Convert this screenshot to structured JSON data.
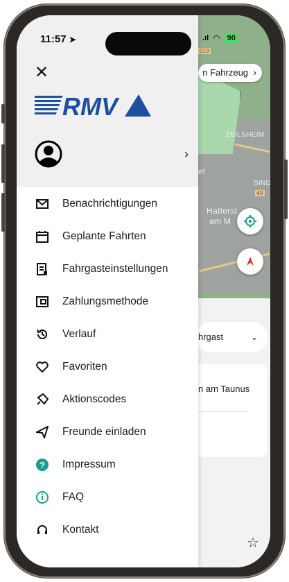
{
  "status_bar": {
    "time": "11:57",
    "battery": "90"
  },
  "map": {
    "chip_label": "n Fahrzeug",
    "labels": [
      "ZEILSHEIM",
      "SINDLIN",
      "Hatterst",
      "am M",
      "el"
    ],
    "route_badge": "40",
    "route_badge_2": "019"
  },
  "sheet": {
    "passenger_select": "hrgast",
    "destination": "n am Taunus"
  },
  "drawer": {
    "brand": "RMV",
    "menu": [
      {
        "label": "Benachrichtigungen",
        "icon": "mail-icon"
      },
      {
        "label": "Geplante Fahrten",
        "icon": "calendar-icon"
      },
      {
        "label": "Fahrgasteinstellungen",
        "icon": "document-icon"
      },
      {
        "label": "Zahlungsmethode",
        "icon": "wallet-icon"
      },
      {
        "label": "Verlauf",
        "icon": "history-icon"
      },
      {
        "label": "Favoriten",
        "icon": "heart-icon"
      },
      {
        "label": "Aktionscodes",
        "icon": "ticket-icon"
      },
      {
        "label": "Freunde einladen",
        "icon": "paper-plane-icon"
      },
      {
        "label": "Impressum",
        "icon": "help-icon"
      },
      {
        "label": "FAQ",
        "icon": "info-icon"
      },
      {
        "label": "Kontakt",
        "icon": "headset-icon"
      }
    ]
  },
  "colors": {
    "accent_teal": "#1a9c8c",
    "brand_blue": "#1d4fa0",
    "map_green": "#8fb08a",
    "drawer_header_bg": "#f0f0f0"
  }
}
